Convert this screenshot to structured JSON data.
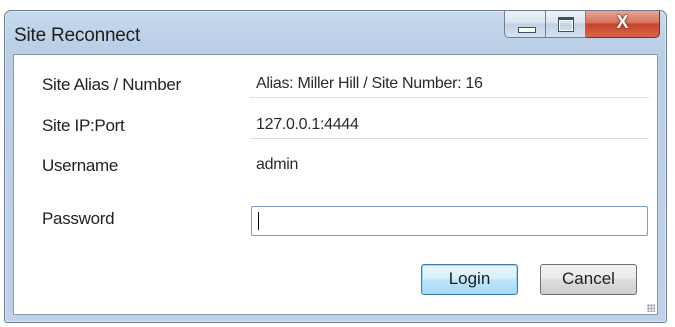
{
  "window": {
    "title": "Site Reconnect",
    "controls": {
      "minimize_icon": "minimize-icon",
      "maximize_icon": "maximize-icon",
      "close_glyph": "X"
    }
  },
  "form": {
    "alias": {
      "label": "Site Alias / Number",
      "value": "Alias: Miller Hill / Site Number: 16"
    },
    "ip": {
      "label": "Site IP:Port",
      "value": "127.0.0.1:4444"
    },
    "username": {
      "label": "Username",
      "value": "admin"
    },
    "password": {
      "label": "Password",
      "value": ""
    }
  },
  "buttons": {
    "login": "Login",
    "cancel": "Cancel"
  },
  "colors": {
    "frame": "#bed3e9",
    "close": "#c7442b",
    "default_button_border": "#3c7fb1"
  }
}
